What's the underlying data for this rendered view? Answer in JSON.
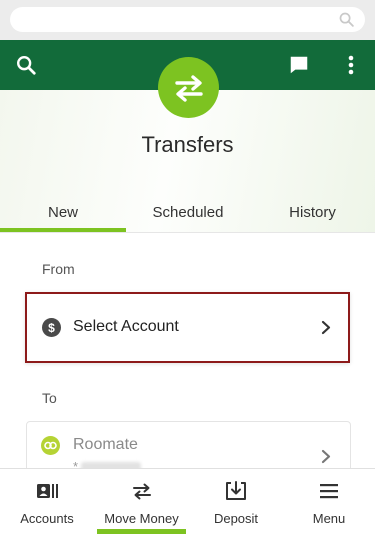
{
  "header": {
    "title": "Transfers",
    "icons": [
      "search-icon",
      "chat-icon",
      "more-vert-icon"
    ],
    "color": "#126b3a"
  },
  "hero": {
    "badge_icon": "transfer-arrows-icon",
    "badge_color": "#7dc321"
  },
  "tabs": [
    {
      "label": "New",
      "active": true
    },
    {
      "label": "Scheduled",
      "active": false
    },
    {
      "label": "History",
      "active": false
    }
  ],
  "form": {
    "from_label": "From",
    "from_placeholder": "Select Account",
    "to_label": "To",
    "to_account": {
      "name": "Roomate",
      "number_prefix": "*"
    }
  },
  "bottom_nav": [
    {
      "label": "Accounts",
      "icon": "accounts-icon",
      "active": false
    },
    {
      "label": "Move Money",
      "icon": "move-money-icon",
      "active": true
    },
    {
      "label": "Deposit",
      "icon": "deposit-icon",
      "active": false
    },
    {
      "label": "Menu",
      "icon": "menu-icon",
      "active": false
    }
  ],
  "colors": {
    "accent": "#7dc321",
    "focus_border": "#8d1a1a"
  }
}
